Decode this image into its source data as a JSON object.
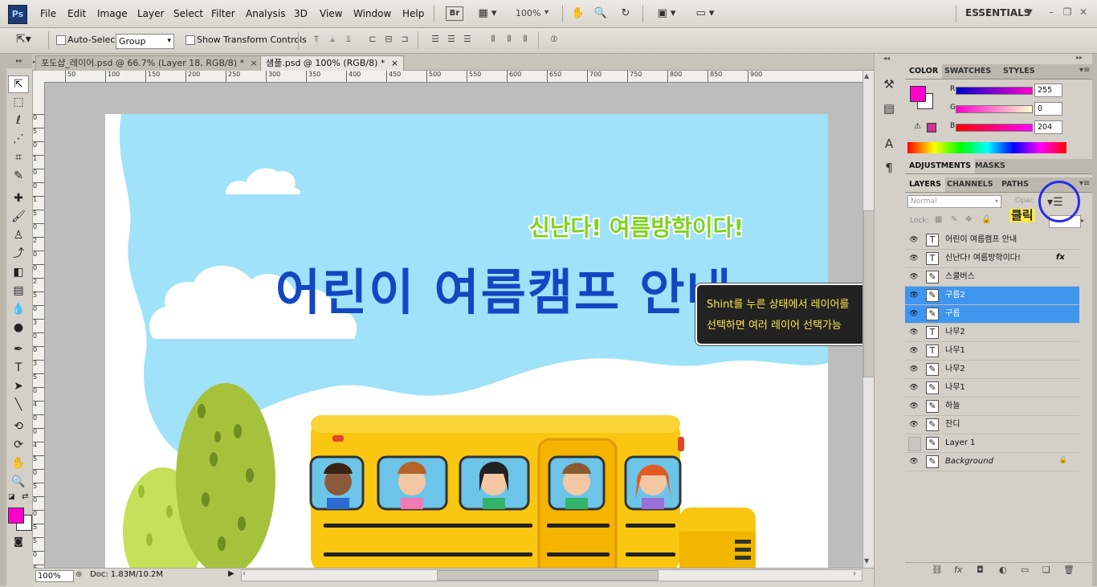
{
  "app": {
    "logo": "Ps"
  },
  "menu": [
    "File",
    "Edit",
    "Image",
    "Layer",
    "Select",
    "Filter",
    "Analysis",
    "3D",
    "View",
    "Window",
    "Help"
  ],
  "app_bar": {
    "bridge": "Br",
    "zoom": "100%",
    "workspace": "ESSENTIALS"
  },
  "options": {
    "auto_select_label": "Auto-Select:",
    "auto_select_value": "Group",
    "show_transform_label": "Show Transform Controls"
  },
  "tabs": [
    {
      "label": "포도샵_레이어.psd @ 66.7% (Layer 18, RGB/8) *",
      "close": "×"
    },
    {
      "label": "샘플.psd @ 100% (RGB/8) *",
      "close": "×"
    }
  ],
  "ruler": {
    "h": [
      "50",
      "100",
      "150",
      "200",
      "250",
      "300",
      "350",
      "400",
      "450",
      "500",
      "550",
      "600",
      "650",
      "700",
      "750",
      "800",
      "850",
      "900"
    ],
    "v": [
      "0",
      "5",
      "0",
      "1",
      "0",
      "0",
      "1",
      "5",
      "0",
      "2",
      "0",
      "0",
      "2",
      "5",
      "0",
      "3",
      "0",
      "0",
      "3",
      "5",
      "0",
      "4",
      "0",
      "0",
      "4",
      "5",
      "0",
      "5",
      "0",
      "0",
      "5",
      "5",
      "0",
      "6"
    ]
  },
  "document": {
    "subtitle": "신난다! 여름방학이다!",
    "headline": "어린이 여름캠프 안내"
  },
  "callout": {
    "line1": "Shint를 누른 상태에서 레이어를",
    "line2": "선택하면 여러 레이어 선택가능"
  },
  "click_label": "클릭",
  "status": {
    "zoom": "100%",
    "doc": "Doc: 1.83M/10.2M"
  },
  "panels": {
    "color_tabs": [
      "COLOR",
      "SWATCHES",
      "STYLES"
    ],
    "adjust_tabs": [
      "ADJUSTMENTS",
      "MASKS"
    ],
    "layer_tabs": [
      "LAYERS",
      "CHANNELS",
      "PATHS"
    ],
    "color": {
      "r": "255",
      "g": "0",
      "b": "204",
      "r_label": "R",
      "g_label": "G",
      "b_label": "B"
    },
    "blend_mode": "Normal",
    "opacity_label": "Opac",
    "lock_label": "Lock:",
    "fx": "fx"
  },
  "layers": [
    {
      "name": "어린이 여름캠프 안내",
      "type": "text",
      "visible": true,
      "selected": false
    },
    {
      "name": "신난다! 여름방학이다!",
      "type": "text",
      "visible": true,
      "selected": false,
      "fx": true
    },
    {
      "name": "스쿨버스",
      "type": "pixel",
      "visible": true,
      "selected": false
    },
    {
      "name": "구름2",
      "type": "pixel",
      "visible": true,
      "selected": true
    },
    {
      "name": "구름",
      "type": "pixel",
      "visible": true,
      "selected": true
    },
    {
      "name": "나무2",
      "type": "text",
      "visible": true,
      "selected": false
    },
    {
      "name": "나무1",
      "type": "text",
      "visible": true,
      "selected": false
    },
    {
      "name": "나무2",
      "type": "pixel",
      "visible": true,
      "selected": false
    },
    {
      "name": "나무1",
      "type": "pixel",
      "visible": true,
      "selected": false
    },
    {
      "name": "하늘",
      "type": "pixel",
      "visible": true,
      "selected": false
    },
    {
      "name": "잔디",
      "type": "pixel",
      "visible": true,
      "selected": false
    },
    {
      "name": "Layer 1",
      "type": "pixel",
      "visible": false,
      "selected": false
    },
    {
      "name": "Background",
      "type": "pixel",
      "visible": true,
      "selected": false,
      "locked": true
    }
  ],
  "colors": {
    "foreground": "#ff00cc",
    "background": "#ffffff",
    "selection": "#3e96ef",
    "sky": "#9fe2f9",
    "headline": "#1346c2",
    "subtitle": "#7ed321",
    "callout_text": "#ffe84a"
  }
}
